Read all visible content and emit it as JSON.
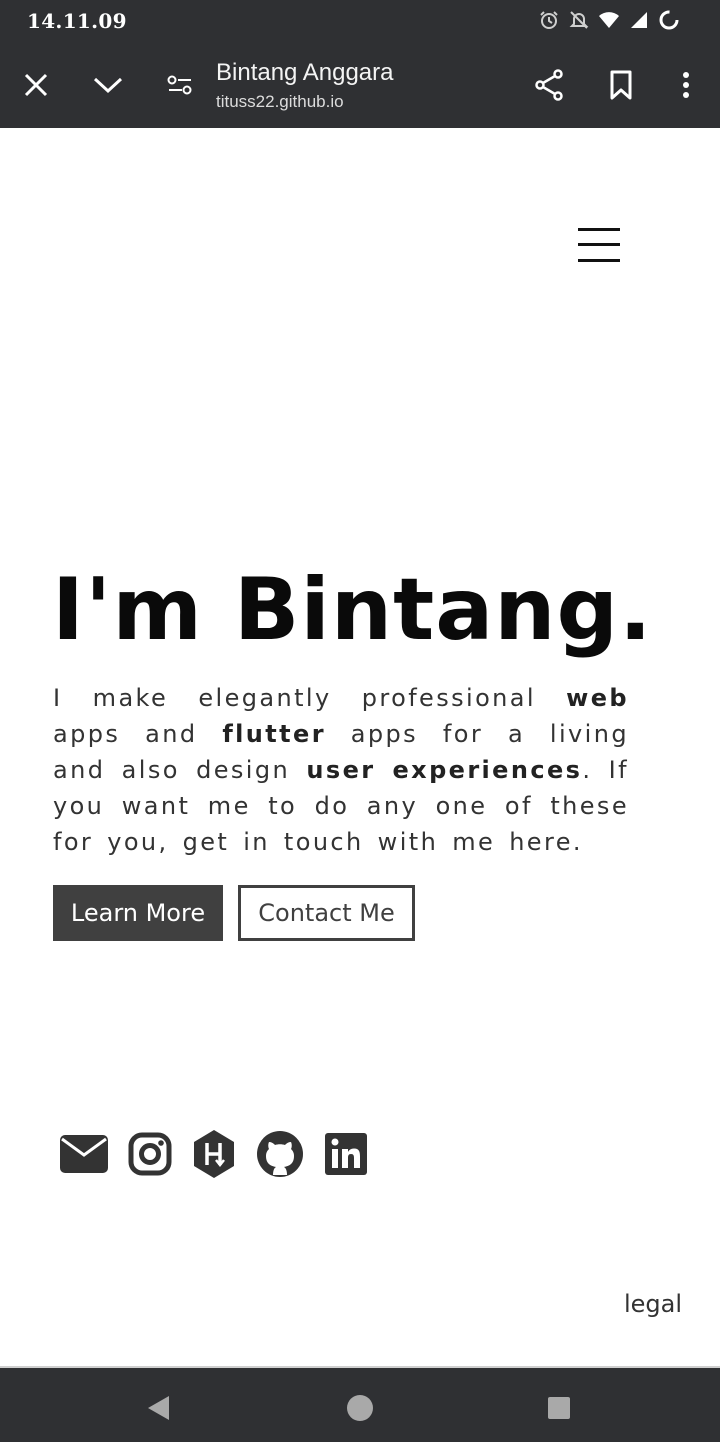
{
  "status_bar": {
    "time": "14.11.09",
    "icons": [
      "alarm-icon",
      "mute-icon",
      "wifi-icon",
      "signal-icon",
      "loading-icon"
    ]
  },
  "toolbar": {
    "title": "Bintang Anggara",
    "url": "tituss22.github.io",
    "icons": [
      "close-icon",
      "chevron-down-icon",
      "site-settings-icon",
      "share-icon",
      "bookmark-icon",
      "more-vert-icon"
    ]
  },
  "hero": {
    "heading": "I'm Bintang.",
    "intro_1": "I make elegantly professional ",
    "intro_web": "web",
    "intro_2": " apps and ",
    "intro_flutter": "flutter",
    "intro_3": " apps for a living and also design ",
    "intro_ux": "user experiences",
    "intro_4": ". If you want me to do any one of these for you, get in touch with me here.",
    "learn_more": "Learn More",
    "contact_me": "Contact Me"
  },
  "social": [
    "email-icon",
    "instagram-icon",
    "hackerrank-icon",
    "github-icon",
    "linkedin-icon"
  ],
  "footer": {
    "legal": "legal"
  },
  "colors": {
    "bar": "#2f3033",
    "button": "#404040",
    "text": "#333333"
  }
}
